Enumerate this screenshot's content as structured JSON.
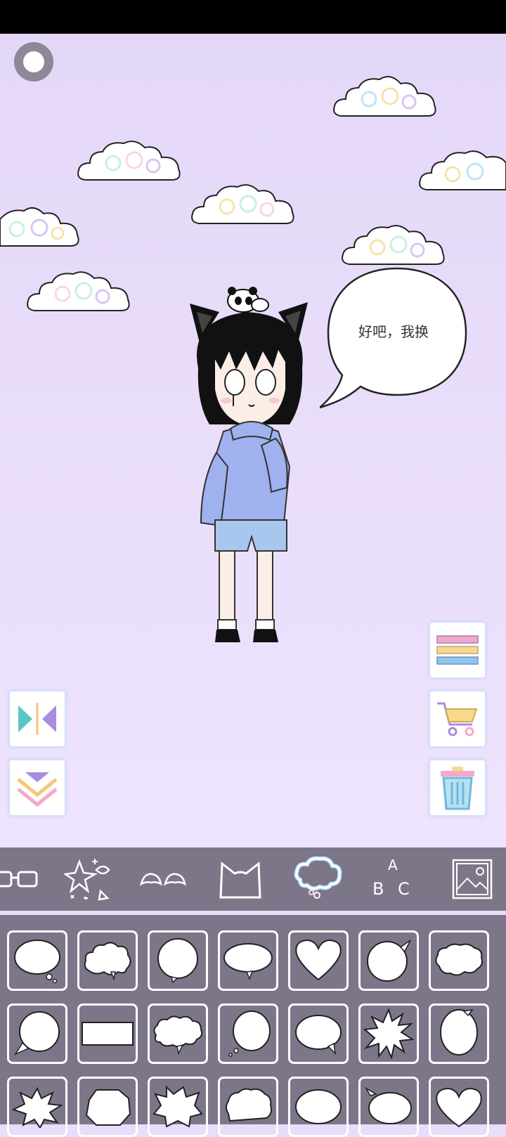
{
  "speech_bubble": {
    "text": "好吧，我换"
  },
  "controls": {
    "record": "record-icon",
    "flip": "flip-horizontal-icon",
    "layer_down": "chevron-down-icon",
    "menu": "menu-lines-icon",
    "shop": "cart-icon",
    "delete": "trash-icon"
  },
  "tabs": [
    {
      "name": "glasses",
      "icon": "glasses-icon",
      "active": false
    },
    {
      "name": "sparkles",
      "icon": "sparkles-icon",
      "active": false
    },
    {
      "name": "ears",
      "icon": "small-ears-icon",
      "active": false
    },
    {
      "name": "cat-ears",
      "icon": "cat-ears-icon",
      "active": false
    },
    {
      "name": "speech-bubble",
      "icon": "speech-bubble-icon",
      "active": true
    },
    {
      "name": "text",
      "icon": "abc-text-icon",
      "active": false,
      "label_a": "A",
      "label_b": "B",
      "label_c": "C"
    },
    {
      "name": "background",
      "icon": "image-icon",
      "active": false
    }
  ],
  "colors": {
    "canvas": "#e6daf9",
    "panel": "#7d7689",
    "menu_pink": "#f5a8c8",
    "menu_yellow": "#f8d98b",
    "menu_blue": "#8fc7ea",
    "flip_teal": "#5cc7c0",
    "flip_purple": "#a98be0",
    "trash_blue": "#6fb7dc"
  }
}
